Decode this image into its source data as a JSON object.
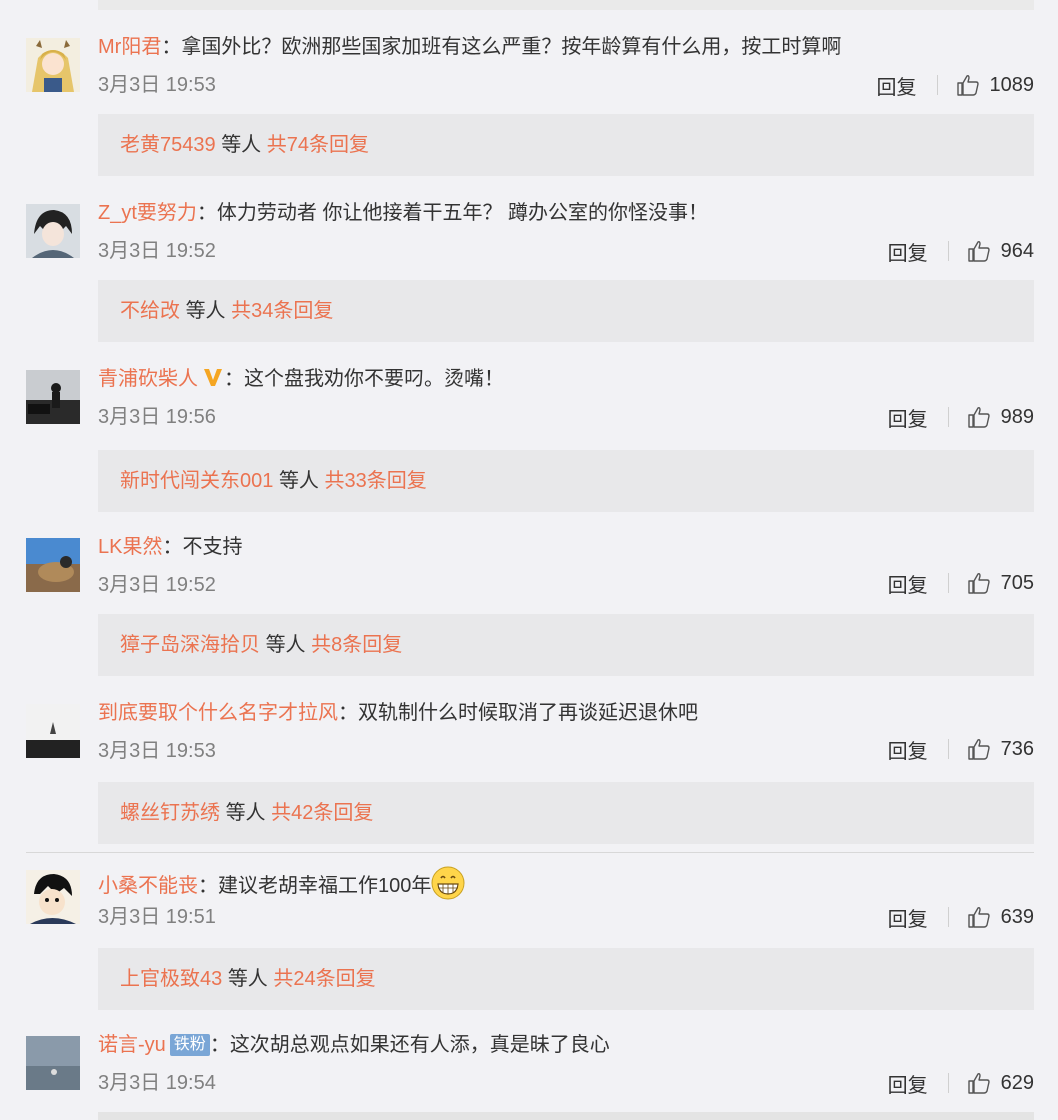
{
  "comments": [
    {
      "username": "Mr阳君",
      "text": "拿国外比？欧洲那些国家加班有这么严重？按年龄算有什么用，按工时算啊",
      "time": "3月3日 19:53",
      "reply_label": "回复",
      "likes": "1089",
      "reply_user": "老黄75439",
      "reply_mid": "等人",
      "reply_count": "共74条回复"
    },
    {
      "username": "Z_yt要努力",
      "text": "体力劳动者 你让他接着干五年？ 蹲办公室的你怪没事！",
      "time": "3月3日 19:52",
      "reply_label": "回复",
      "likes": "964",
      "reply_user": "不给改",
      "reply_mid": "等人",
      "reply_count": "共34条回复"
    },
    {
      "username": "青浦砍柴人",
      "text": "这个盘我劝你不要叼。烫嘴！",
      "time": "3月3日 19:56",
      "reply_label": "回复",
      "likes": "989",
      "reply_user": "新时代闯关东001",
      "reply_mid": "等人",
      "reply_count": "共33条回复"
    },
    {
      "username": "LK果然",
      "text": "不支持",
      "time": "3月3日 19:52",
      "reply_label": "回复",
      "likes": "705",
      "reply_user": "獐子岛深海拾贝",
      "reply_mid": "等人",
      "reply_count": "共8条回复"
    },
    {
      "username": "到底要取个什么名字才拉风",
      "text": "双轨制什么时候取消了再谈延迟退休吧",
      "time": "3月3日 19:53",
      "reply_label": "回复",
      "likes": "736",
      "reply_user": "螺丝钉苏绣",
      "reply_mid": "等人",
      "reply_count": "共42条回复"
    },
    {
      "username": "小桑不能丧",
      "text": "建议老胡幸福工作100年",
      "time": "3月3日 19:51",
      "reply_label": "回复",
      "likes": "639",
      "reply_user": "上官极致43",
      "reply_mid": "等人",
      "reply_count": "共24条回复"
    },
    {
      "username": "诺言-yu",
      "badge": "铁粉",
      "text": "这次胡总观点如果还有人添，真是昧了良心",
      "time": "3月3日 19:54",
      "reply_label": "回复",
      "likes": "629"
    }
  ],
  "colon": "：",
  "colors": {
    "username": "#eb7350",
    "background": "#f2f2f5",
    "reply_box": "#e8e8ea",
    "badge_fan": "#7aa6d6"
  }
}
